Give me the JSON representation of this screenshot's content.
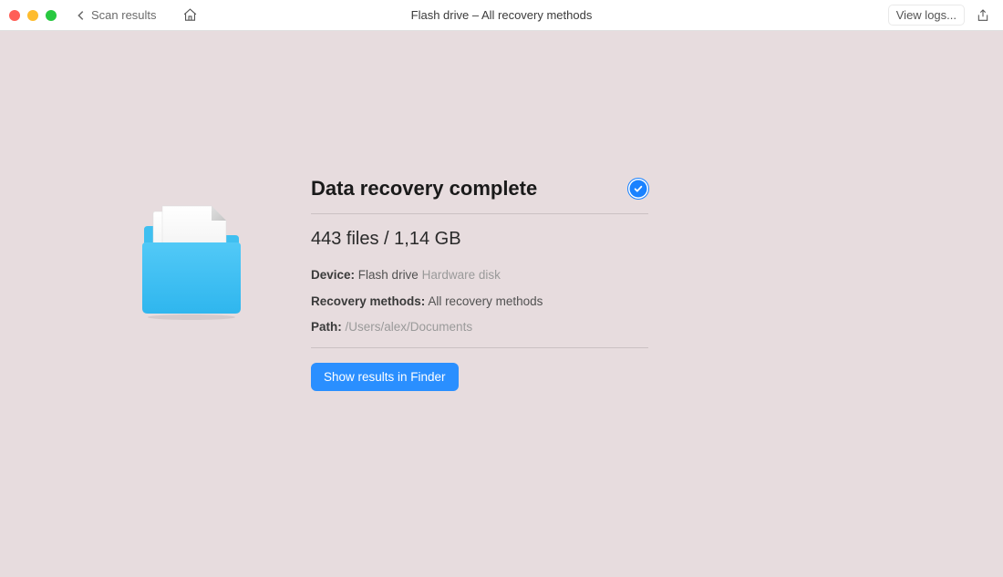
{
  "toolbar": {
    "back_label": "Scan results",
    "window_title": "Flash drive – All recovery methods",
    "view_logs_label": "View logs..."
  },
  "main": {
    "heading": "Data recovery complete",
    "stats": "443 files / 1,14 GB",
    "device_label": "Device:",
    "device_value": "Flash drive",
    "device_type": "Hardware disk",
    "methods_label": "Recovery methods:",
    "methods_value": "All recovery methods",
    "path_label": "Path:",
    "path_value": "/Users/alex/Documents",
    "show_results_label": "Show results in Finder"
  }
}
